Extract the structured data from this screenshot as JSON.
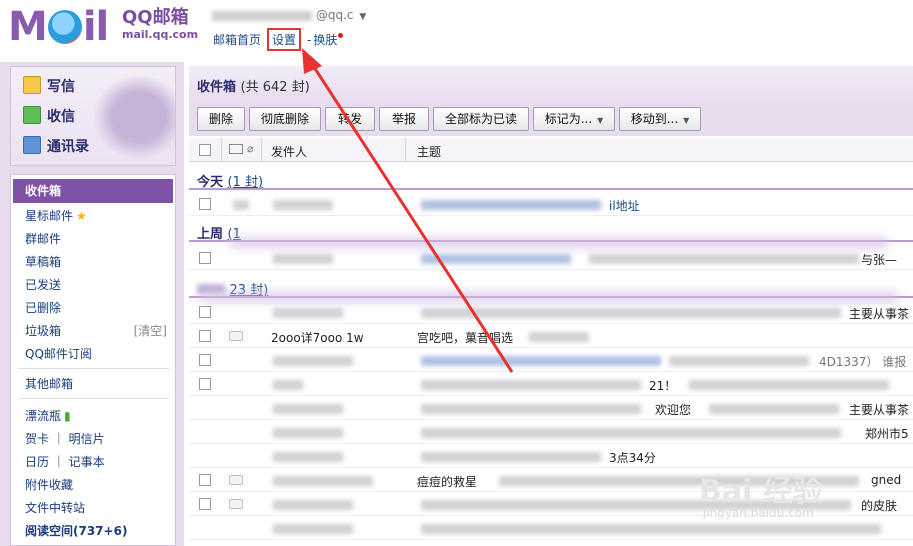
{
  "header": {
    "logo_text": "MOil",
    "brand_title": "QQ邮箱",
    "brand_url": "mail.qq.com",
    "account_suffix": "@qq.c",
    "nav": {
      "home": "邮箱首页",
      "settings": "设置",
      "sep": "-",
      "skin": "换肤"
    }
  },
  "sidebar": {
    "quick": {
      "write": "写信",
      "receive": "收信",
      "contacts": "通讯录"
    },
    "folders": [
      {
        "label": "收件箱"
      },
      {
        "label": "星标邮件",
        "icon": "★"
      },
      {
        "label": "群邮件"
      },
      {
        "label": "草稿箱"
      },
      {
        "label": "已发送"
      },
      {
        "label": "已删除"
      },
      {
        "label": "垃圾箱"
      },
      {
        "label": "QQ邮件订阅"
      }
    ],
    "clear_label": "[清空]",
    "other": "其他邮箱",
    "extras": [
      {
        "label": "漂流瓶"
      },
      {
        "label": "贺卡 ｜ 明信片"
      },
      {
        "label": "日历 ｜ 记事本"
      },
      {
        "label": "附件收藏"
      },
      {
        "label": "文件中转站"
      },
      {
        "label": "阅读空间(737+6)"
      }
    ]
  },
  "main": {
    "title": "收件箱",
    "count": "(共 642 封)",
    "toolbar": {
      "delete": "删除",
      "delete_forever": "彻底删除",
      "forward": "转发",
      "report": "举报",
      "mark_all_read": "全部标为已读",
      "mark_as": "标记为...",
      "move_to": "移动到..."
    },
    "columns": {
      "sender": "发件人",
      "subject": "主题"
    },
    "groups": {
      "today": {
        "name": "今天",
        "count": "(1 封)"
      },
      "last_week": {
        "name": "上周",
        "count": "(1"
      },
      "earlier": {
        "count": "23 封)"
      }
    },
    "rows": {
      "r1_subject_tail": "il地址",
      "r2_subject_tail": "与张—",
      "r3_subject_tail": "主要从事茶",
      "r4_sender": "2ooo详7ooo 1w",
      "r4_subject": "宫吃吧，菓音唱选",
      "r5_subject_tail": "4D1337）   谁报",
      "r6_subject_tail": "21！",
      "r7_subject": "欢迎您",
      "r7_subject_tail": "主要从事茶",
      "r8_subject_tail": "郑州市5",
      "r9_subject_tail": "3点34分",
      "r10_subject": "痘痘的救星",
      "r10_subject_tail": "gned",
      "r11_subject_tail": "的皮肤"
    },
    "watermark": {
      "main": "Bai 经验",
      "sub": "jingyan.baidu.com"
    }
  },
  "colors": {
    "accent": "#7e52a6",
    "annotation": "#e8322f",
    "link": "#1a4b8c"
  }
}
